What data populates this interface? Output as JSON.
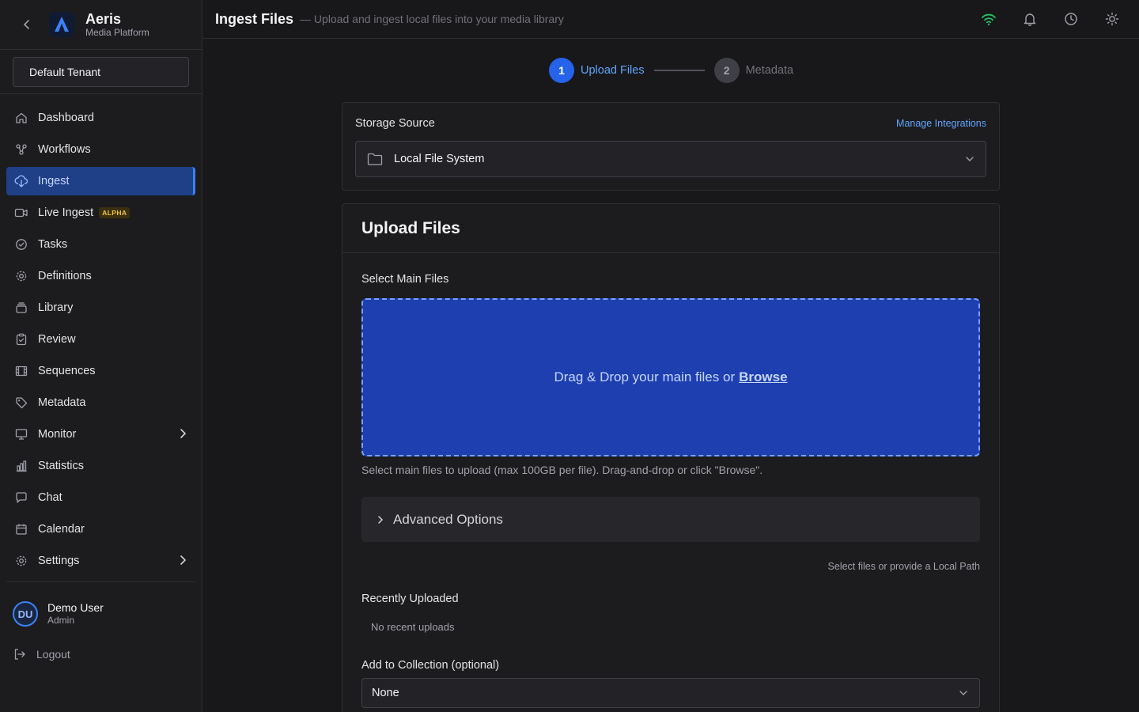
{
  "app": {
    "name": "Aeris",
    "subtitle": "Media Platform"
  },
  "tenant": {
    "label": "Default Tenant"
  },
  "nav": {
    "items": [
      {
        "label": "Dashboard",
        "icon": "home-icon"
      },
      {
        "label": "Workflows",
        "icon": "workflow-icon"
      },
      {
        "label": "Ingest",
        "icon": "cloud-download-icon",
        "active": true
      },
      {
        "label": "Live Ingest",
        "icon": "video-icon",
        "badge": "ALPHA"
      },
      {
        "label": "Tasks",
        "icon": "check-circle-icon"
      },
      {
        "label": "Definitions",
        "icon": "gear-icon"
      },
      {
        "label": "Library",
        "icon": "library-icon"
      },
      {
        "label": "Review",
        "icon": "clipboard-check-icon"
      },
      {
        "label": "Sequences",
        "icon": "film-icon"
      },
      {
        "label": "Metadata",
        "icon": "tag-icon"
      },
      {
        "label": "Monitor",
        "icon": "monitor-icon",
        "expandable": true
      },
      {
        "label": "Statistics",
        "icon": "bar-chart-icon"
      },
      {
        "label": "Chat",
        "icon": "chat-icon"
      },
      {
        "label": "Calendar",
        "icon": "calendar-icon"
      },
      {
        "label": "Settings",
        "icon": "gear-icon",
        "expandable": true
      }
    ]
  },
  "user": {
    "initials": "DU",
    "name": "Demo User",
    "role": "Admin"
  },
  "logout": {
    "label": "Logout"
  },
  "header": {
    "title": "Ingest Files",
    "subtitle": "— Upload and ingest local files into your media library",
    "icons": [
      "wifi-icon",
      "bell-icon",
      "clock-icon",
      "sun-icon"
    ]
  },
  "stepper": {
    "steps": [
      {
        "num": "1",
        "label": "Upload Files",
        "active": true
      },
      {
        "num": "2",
        "label": "Metadata",
        "active": false
      }
    ]
  },
  "storage": {
    "label": "Storage Source",
    "manage_link": "Manage Integrations",
    "selected": "Local File System"
  },
  "upload": {
    "title": "Upload Files",
    "main_files_label": "Select Main Files",
    "dropzone_text": "Drag & Drop your main files or",
    "browse_label": "Browse",
    "hint": "Select main files to upload (max 100GB per file). Drag-and-drop or click \"Browse\".",
    "advanced_label": "Advanced Options",
    "side_hint": "Select files or provide a Local Path",
    "recent_label": "Recently Uploaded",
    "recent_empty": "No recent uploads",
    "collection_label": "Add to Collection (optional)",
    "collection_value": "None"
  },
  "colors": {
    "accent": "#2563eb",
    "dropzone_bg": "#1e3faf",
    "badge": "#f4c542",
    "wifi": "#22c55e"
  }
}
